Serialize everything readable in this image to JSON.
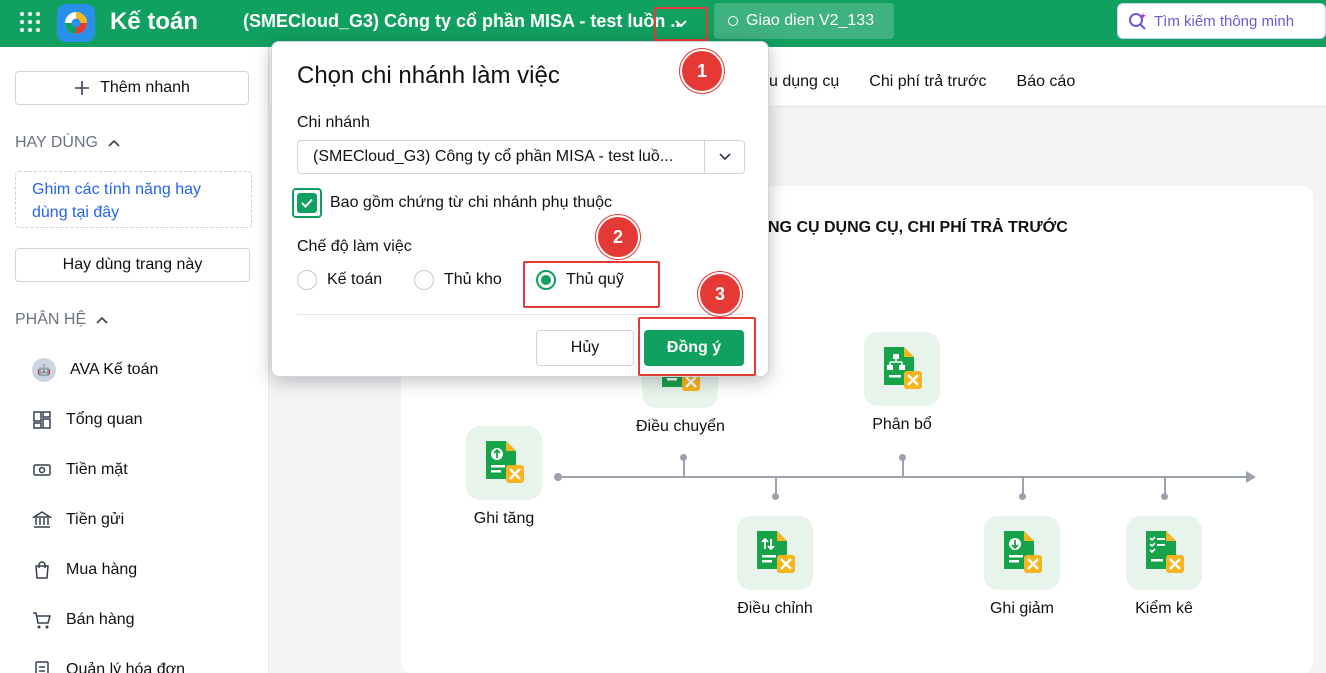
{
  "topbar": {
    "app_name": "Kế toán",
    "company": "(SMECloud_G3) Công ty cổ phần MISA - test luồn ..",
    "ui_version": "Giao dien V2_133",
    "smart_search_placeholder": "Tìm kiếm thông minh"
  },
  "sidebar": {
    "quick_add": "Thêm nhanh",
    "frequent_title": "HAY DÙNG",
    "pin_hint": "Ghim các tính năng hay dùng tại đây",
    "frequent_page": "Hay dùng trang này",
    "modules_title": "PHÂN HỆ",
    "items": [
      {
        "label": "AVA Kế toán",
        "icon": "ava-avatar-icon"
      },
      {
        "label": "Tổng quan",
        "icon": "dashboard-icon"
      },
      {
        "label": "Tiền mặt",
        "icon": "cash-icon"
      },
      {
        "label": "Tiền gửi",
        "icon": "bank-icon"
      },
      {
        "label": "Mua hàng",
        "icon": "shopping-bag-icon"
      },
      {
        "label": "Bán hàng",
        "icon": "cart-icon"
      },
      {
        "label": "Quản lý hóa đơn",
        "icon": "invoice-icon"
      }
    ]
  },
  "tabs": [
    "u dụng cụ",
    "Chi phí trả trước",
    "Báo cáo"
  ],
  "panel": {
    "title": "NG CỤ DỤNG CỤ, CHI PHÍ TRẢ TRƯỚC",
    "nodes": {
      "ghi_tang": "Ghi tăng",
      "dieu_chuyen": "Điều chuyển",
      "phan_bo": "Phân bổ",
      "dieu_chinh": "Điều chỉnh",
      "ghi_giam": "Ghi giảm",
      "kiem_ke": "Kiểm kê"
    }
  },
  "dialog": {
    "title": "Chọn chi nhánh làm việc",
    "branch_label": "Chi nhánh",
    "branch_value": "(SMECloud_G3) Công ty cổ phần MISA - test luồ...",
    "include_dependent": "Bao gồm chứng từ chi nhánh phụ thuộc",
    "include_dependent_checked": true,
    "mode_label": "Chế độ làm việc",
    "modes": [
      "Kế toán",
      "Thủ kho",
      "Thủ quỹ"
    ],
    "selected_mode": "Thủ quỹ",
    "cancel": "Hủy",
    "confirm": "Đồng ý"
  },
  "steps": [
    "1",
    "2",
    "3"
  ],
  "colors": {
    "brand": "#10a060",
    "highlight": "#e53935"
  }
}
